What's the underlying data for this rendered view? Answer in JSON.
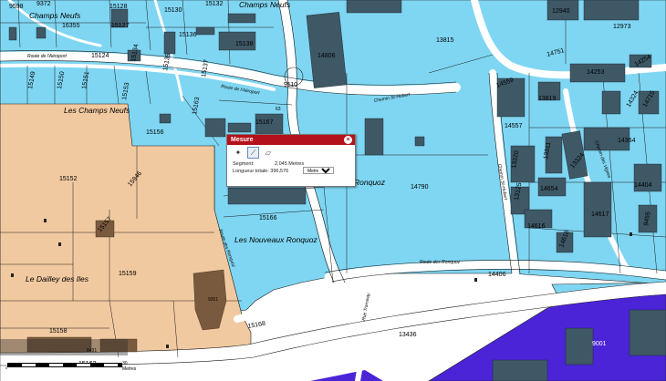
{
  "colors": {
    "blue_zone": "#7fd6f2",
    "tan_zone": "#f1c9a0",
    "building": "#3e5866",
    "tan_building": "#7a5a3e",
    "purple_zone": "#4b24d8",
    "road": "#ffffff",
    "panel_header": "#b4121a"
  },
  "labels": {
    "champs_neufs_top_left": "Champs Neufs",
    "champs_neufs_top": "Champs Neufs",
    "les_champs_neufs": "Les Champs Neufs",
    "ronquoz": "Ronquoz",
    "nouveaux_ronquoz": "Les Nouveaux Ronquoz",
    "dailley": "Le Dailley des Iles",
    "route_aeroport_1": "Route de l'Aéroport",
    "route_aeroport_2": "Route de l'Aéroport",
    "chemin_hubert": "Chemin St-Hubert",
    "route_ronquoz": "Route des Ronquoz",
    "route_ronquoz_v": "Route des Ronquoz",
    "rue_tramway": "Rue Tramway",
    "chemin_vignes": "Chemin des Vignes",
    "chemin_bas": "Chemin St-Hubert"
  },
  "parcels": {
    "p9598": "9598",
    "p9372": "9372",
    "p15128": "15128",
    "p15130": "15130",
    "p15132": "15132",
    "p16355": "16355",
    "p15127": "15127",
    "p15136": "15136",
    "p15138": "15138",
    "p15124": "15124",
    "p15134": "15134",
    "p15135": "15135",
    "p15137": "15137",
    "p15149": "15149",
    "p15150": "15150",
    "p15151": "15151",
    "p15153": "15153",
    "p14806": "14806",
    "p13815": "13815",
    "p9110": "9110",
    "p12940": "12940",
    "p12973": "12973",
    "p14751": "14751",
    "p14253": "14253",
    "p14254": "14254",
    "p14559": "14559",
    "p13819": "13819",
    "p14557": "14557",
    "p14324": "14324",
    "p14715": "14715",
    "p14364": "14364",
    "p15167": "15167",
    "p15163": "15163",
    "p15156": "15156",
    "p15152": "15152",
    "p15946": "15946",
    "p14790": "14790",
    "p13320": "13320",
    "p13311": "13311",
    "p13324": "13324",
    "p14654": "14654",
    "p14404": "14404",
    "p13125": "13125",
    "p14616": "14616",
    "p14617": "14617",
    "p14618": "14618",
    "p15166": "15166",
    "p15157": "15157",
    "p15159": "15159",
    "p14406": "14406",
    "p9455": "9455",
    "p15158": "15158",
    "p15168": "15168",
    "p13436": "13436",
    "p9001": "9001",
    "p15162": "15162",
    "p9351": "9351",
    "p8431": "8431",
    "p63": "63"
  },
  "measure": {
    "title": "Mesure",
    "close": "×",
    "tool_point": "✦",
    "tool_line": "⟋",
    "tool_area": "▱",
    "segment_label": "Segment:",
    "segment_value": "2,045 Metres",
    "total_label": "Longueur totale: 396,576",
    "unit_selected": "Metres"
  },
  "scale": {
    "zero": "0",
    "label": "30 Metres"
  }
}
